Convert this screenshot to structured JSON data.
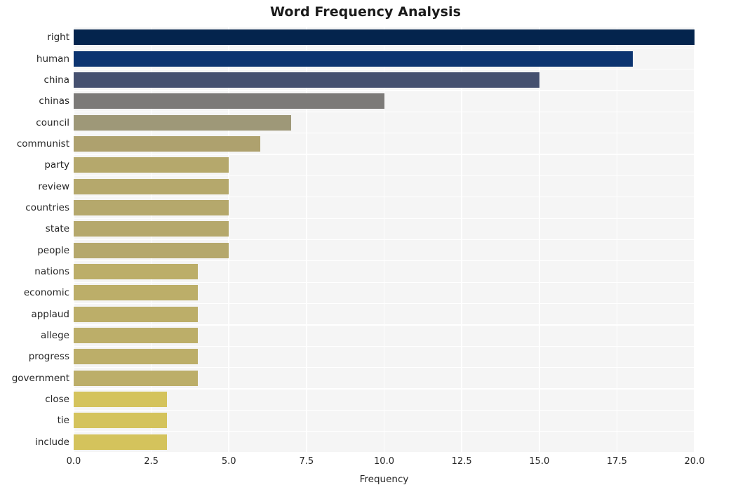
{
  "chart_data": {
    "type": "bar",
    "orientation": "horizontal",
    "title": "Word Frequency Analysis",
    "xlabel": "Frequency",
    "ylabel": "",
    "categories": [
      "right",
      "human",
      "china",
      "chinas",
      "council",
      "communist",
      "party",
      "review",
      "countries",
      "state",
      "people",
      "nations",
      "economic",
      "applaud",
      "allege",
      "progress",
      "government",
      "close",
      "tie",
      "include"
    ],
    "values": [
      20,
      18,
      15,
      10,
      7,
      6,
      5,
      5,
      5,
      5,
      5,
      4,
      4,
      4,
      4,
      4,
      4,
      3,
      3,
      3
    ],
    "bar_colors": [
      "#04244d",
      "#0c3470",
      "#45506f",
      "#7c7a78",
      "#9e9878",
      "#aea16e",
      "#b5a86c",
      "#b5a86c",
      "#b5a86c",
      "#b5a86c",
      "#b5a86c",
      "#bcae69",
      "#bcae69",
      "#bcae69",
      "#bcae69",
      "#bcae69",
      "#bcae69",
      "#d4c35c",
      "#d4c35c",
      "#d4c35c"
    ],
    "xlim": [
      0,
      20
    ],
    "xticks": [
      0,
      2.5,
      5,
      7.5,
      10,
      12.5,
      15,
      17.5,
      20
    ],
    "xtick_labels": [
      "0.0",
      "2.5",
      "5.0",
      "7.5",
      "10.0",
      "12.5",
      "15.0",
      "17.5",
      "20.0"
    ],
    "grid": true,
    "legend": null,
    "plot_background": "#f5f5f5",
    "grid_color": "#ffffff",
    "figure_background": "#ffffff"
  }
}
